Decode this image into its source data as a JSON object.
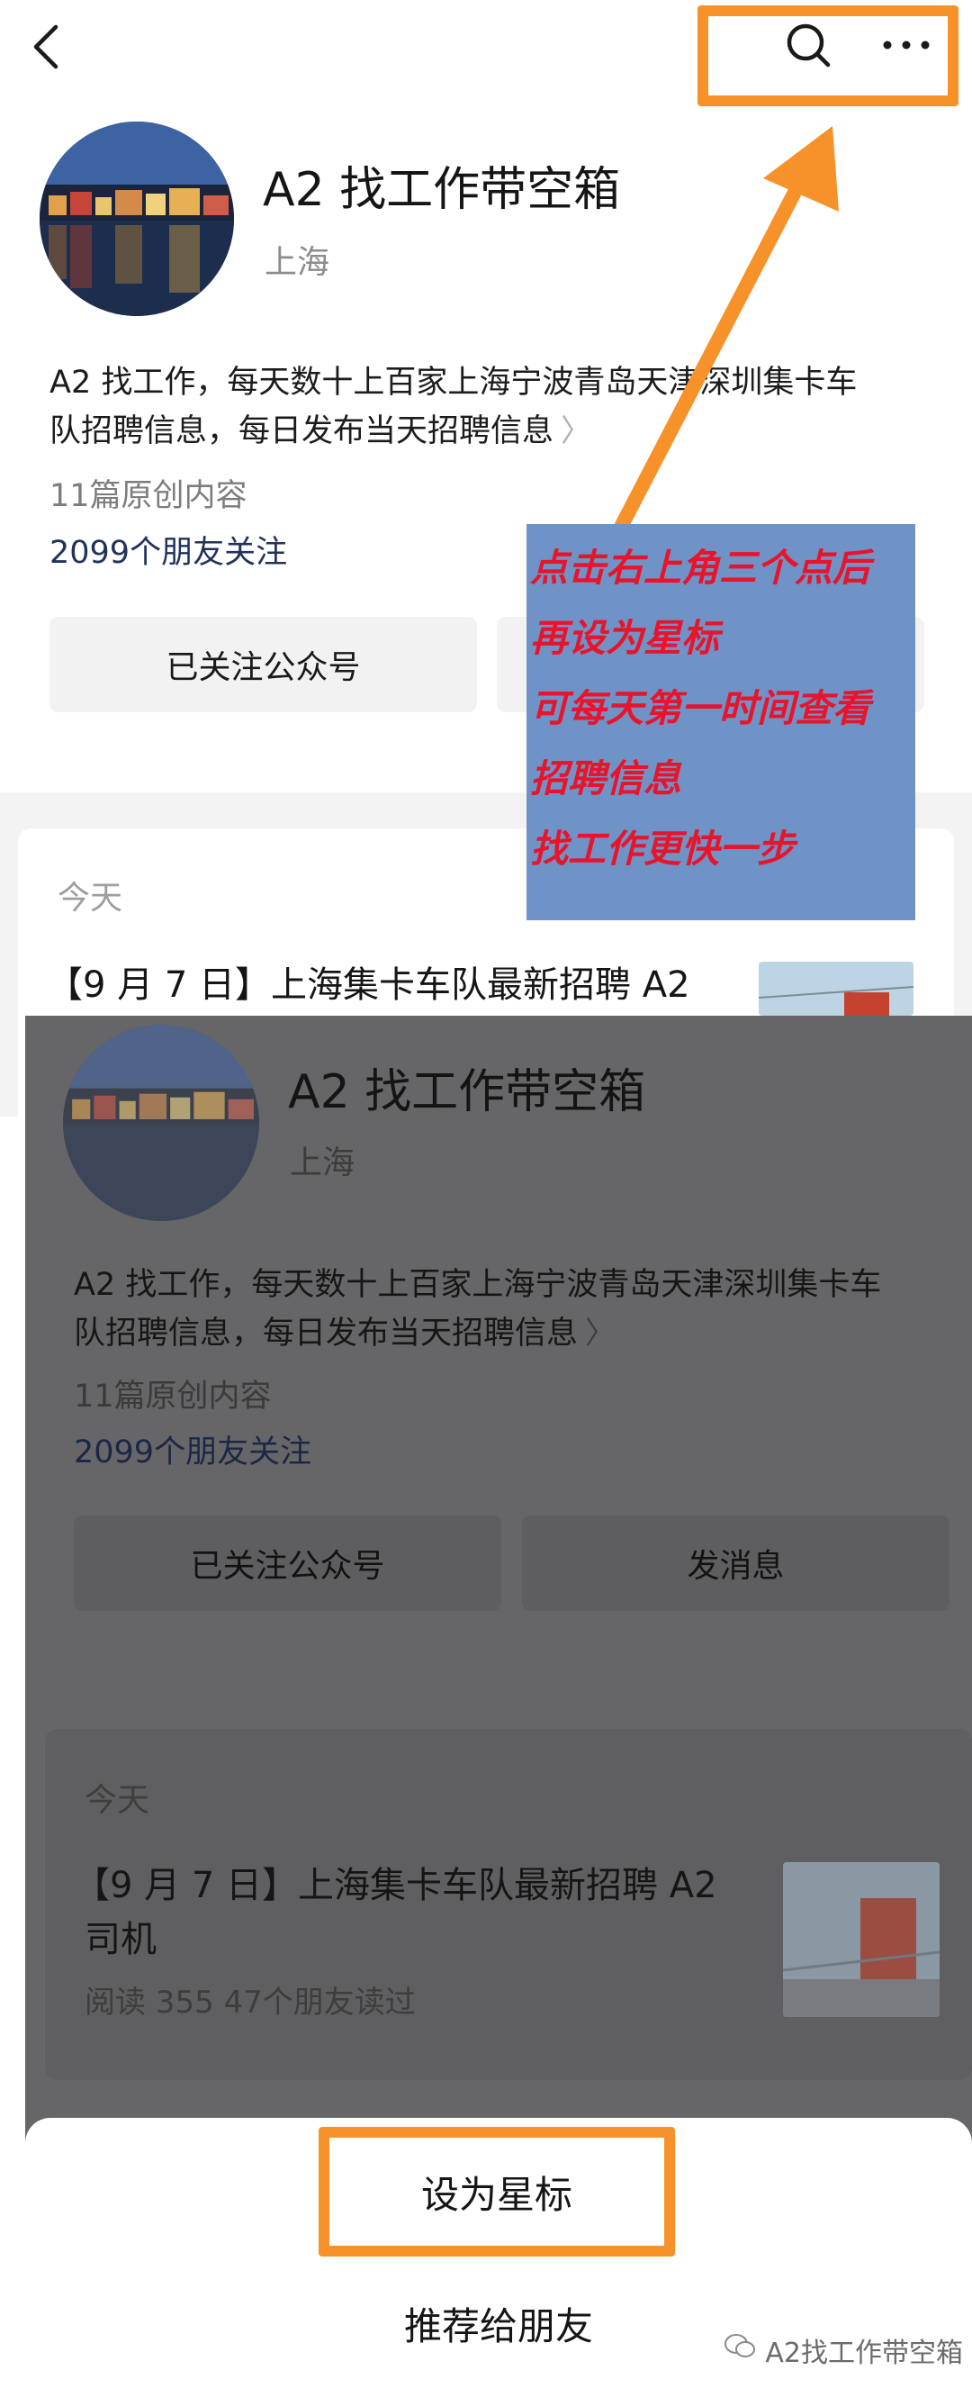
{
  "header": {
    "back_icon": "chevron-left-icon",
    "search_icon": "search-icon",
    "more_icon": "more-horizontal-icon"
  },
  "account": {
    "name": "A2 找工作带空箱",
    "location": "上海",
    "description_line1": "A2 找工作，每天数十上百家上海宁波青岛天津深圳集卡车",
    "description_line2": "队招聘信息，每日发布当天招聘信息",
    "originals": "11篇原创内容",
    "followers": "2099个朋友关注",
    "followed_button": "已关注公众号",
    "message_button": "发消息"
  },
  "annotation": {
    "lines": [
      "点击右上角三个点后",
      "再设为星标",
      "可每天第一时间查看",
      "招聘信息",
      "找工作更快一步"
    ],
    "highlight_color": "#f7922a",
    "text_color": "#e8142c"
  },
  "articles": {
    "section_label": "今天",
    "first_title_line1": "【9 月 7 日】上海集卡车队最新招聘 A2",
    "first_title_line2": "司机",
    "first_stats": "阅读 355   47个朋友读过"
  },
  "sheet": {
    "star_label": "设为星标",
    "share_label": "推荐给朋友"
  },
  "watermark": {
    "text": "A2找工作带空箱",
    "icon": "wechat-icon"
  }
}
